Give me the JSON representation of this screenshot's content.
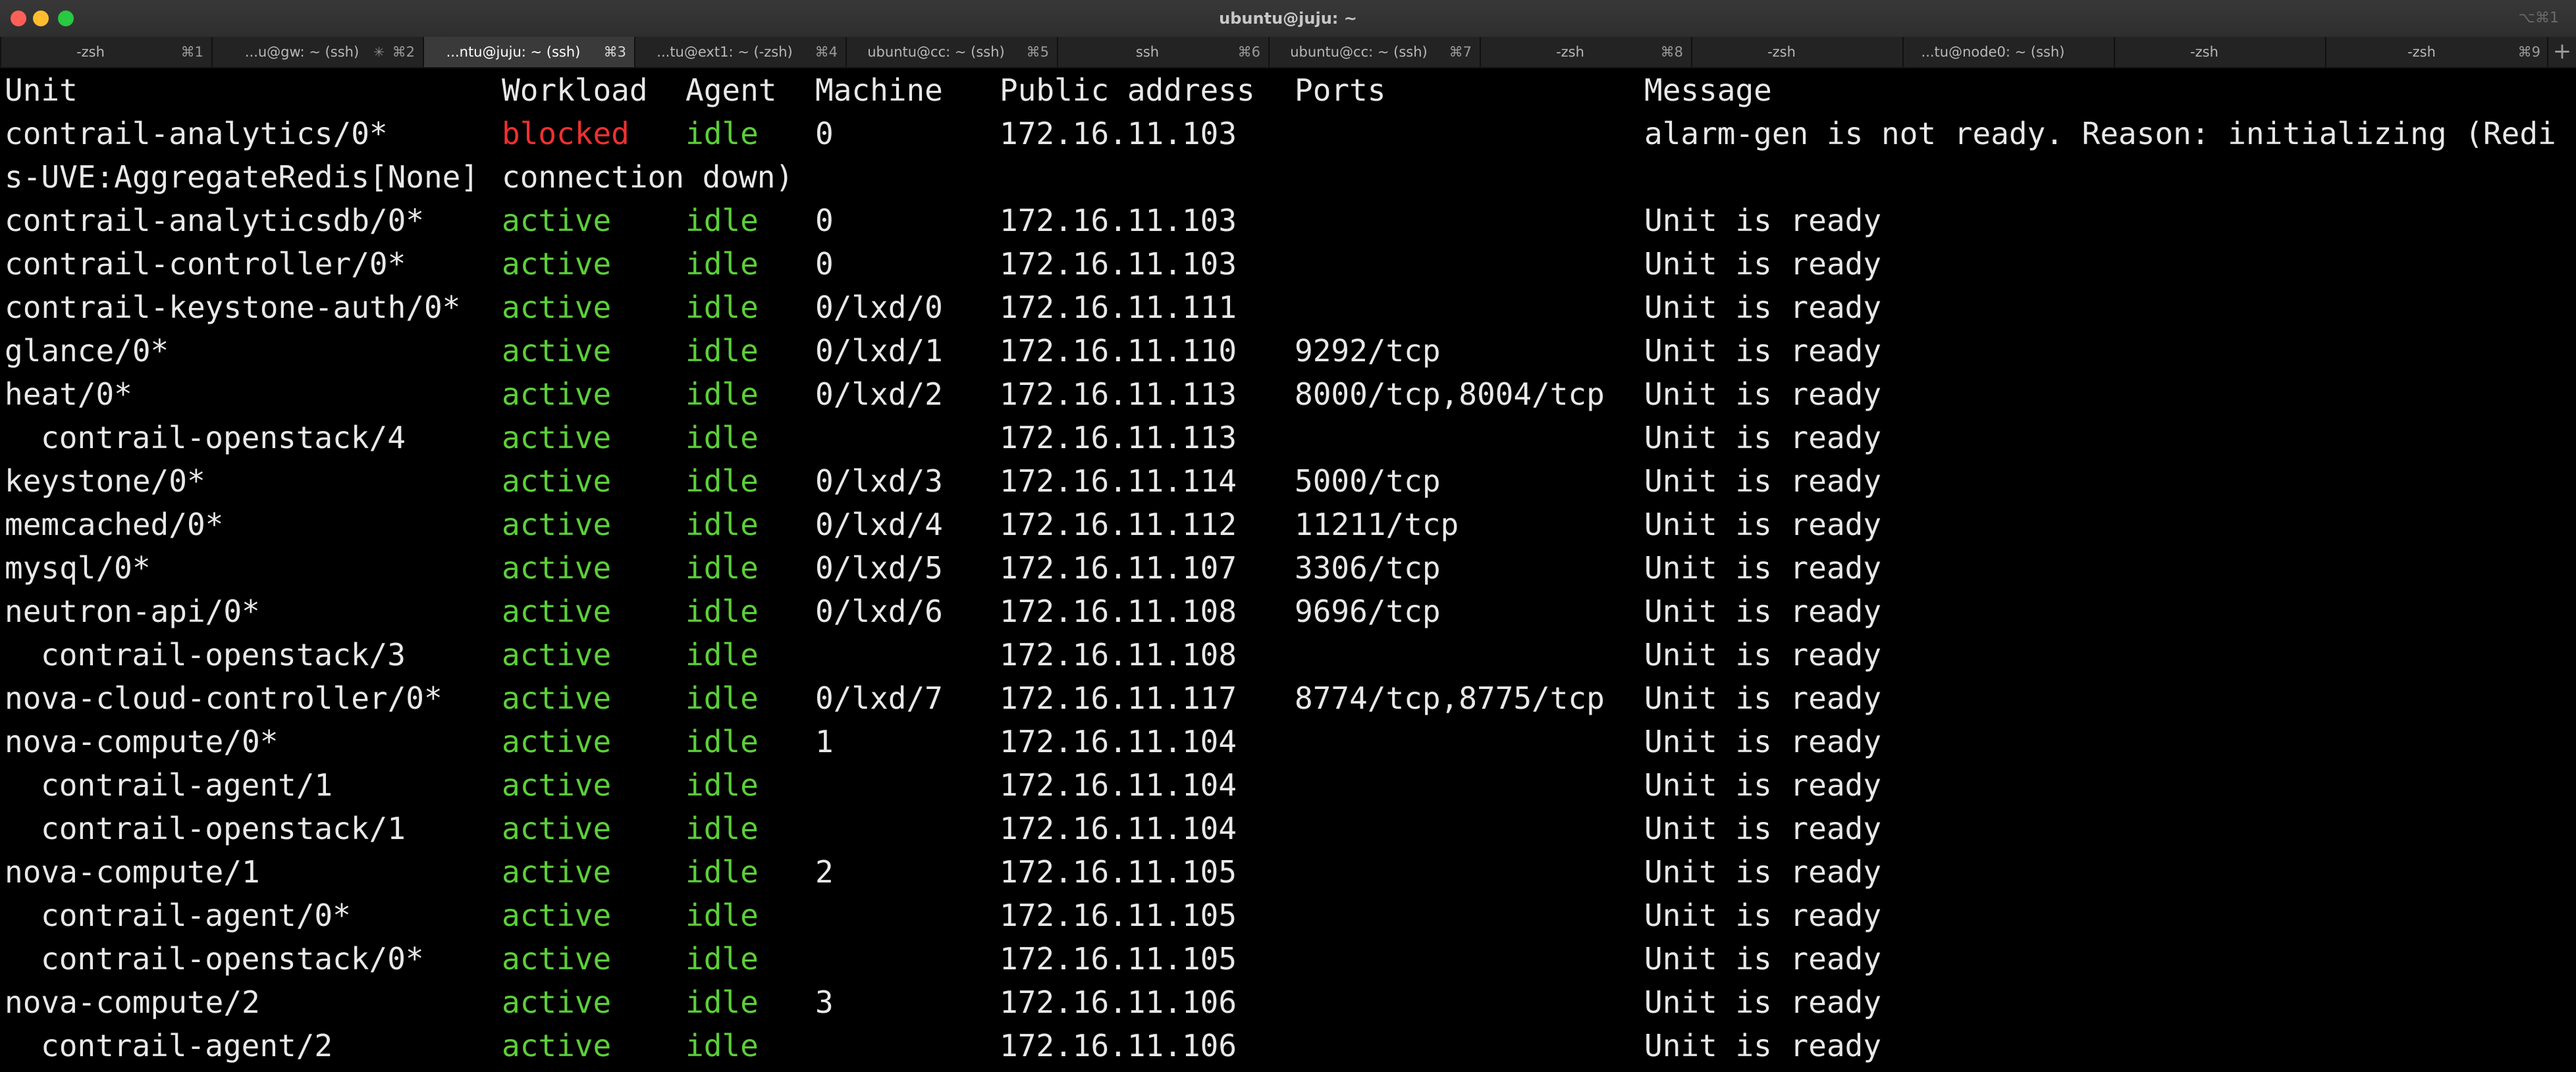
{
  "window": {
    "title": "ubuntu@juju: ~",
    "shortcut": "⌥⌘1"
  },
  "tabs": [
    {
      "label": "-zsh",
      "shortcut": "⌘1",
      "active": false
    },
    {
      "label": "...u@gw: ~ (ssh)",
      "shortcut": "⌘2",
      "active": false,
      "activity_icon": "activity-spinner-icon"
    },
    {
      "label": "...ntu@juju: ~ (ssh)",
      "shortcut": "⌘3",
      "active": true
    },
    {
      "label": "...tu@ext1: ~ (-zsh)",
      "shortcut": "⌘4",
      "active": false
    },
    {
      "label": "ubuntu@cc: ~ (ssh)",
      "shortcut": "⌘5",
      "active": false
    },
    {
      "label": "ssh",
      "shortcut": "⌘6",
      "active": false
    },
    {
      "label": "ubuntu@cc: ~ (ssh)",
      "shortcut": "⌘7",
      "active": false
    },
    {
      "label": "-zsh",
      "shortcut": "⌘8",
      "active": false
    },
    {
      "label": "-zsh",
      "shortcut": "",
      "active": false
    },
    {
      "label": "...tu@node0: ~ (ssh)",
      "shortcut": "",
      "active": false
    },
    {
      "label": "-zsh",
      "shortcut": "",
      "active": false
    },
    {
      "label": "-zsh",
      "shortcut": "⌘9",
      "active": false
    }
  ],
  "new_tab_label": "+",
  "table": {
    "header": {
      "unit": "Unit",
      "workload": "Workload",
      "agent": "Agent",
      "machine": "Machine",
      "address": "Public address",
      "ports": "Ports",
      "message": "Message"
    },
    "rows": [
      {
        "unit": "contrail-analytics/0*",
        "workload": "blocked",
        "agent": "idle",
        "machine": "0",
        "address": "172.16.11.103",
        "ports": "",
        "message": "alarm-gen is not ready. Reason: initializing (Redi"
      },
      {
        "unit": "s-UVE:AggregateRedis[None]",
        "workload": "connection down)",
        "agent": "",
        "machine": "",
        "address": "",
        "ports": "",
        "message": "",
        "continuation": true
      },
      {
        "unit": "contrail-analyticsdb/0*",
        "workload": "active",
        "agent": "idle",
        "machine": "0",
        "address": "172.16.11.103",
        "ports": "",
        "message": "Unit is ready"
      },
      {
        "unit": "contrail-controller/0*",
        "workload": "active",
        "agent": "idle",
        "machine": "0",
        "address": "172.16.11.103",
        "ports": "",
        "message": "Unit is ready"
      },
      {
        "unit": "contrail-keystone-auth/0*",
        "workload": "active",
        "agent": "idle",
        "machine": "0/lxd/0",
        "address": "172.16.11.111",
        "ports": "",
        "message": "Unit is ready"
      },
      {
        "unit": "glance/0*",
        "workload": "active",
        "agent": "idle",
        "machine": "0/lxd/1",
        "address": "172.16.11.110",
        "ports": "9292/tcp",
        "message": "Unit is ready"
      },
      {
        "unit": "heat/0*",
        "workload": "active",
        "agent": "idle",
        "machine": "0/lxd/2",
        "address": "172.16.11.113",
        "ports": "8000/tcp,8004/tcp",
        "message": "Unit is ready"
      },
      {
        "unit": "contrail-openstack/4",
        "workload": "active",
        "agent": "idle",
        "machine": "",
        "address": "172.16.11.113",
        "ports": "",
        "message": "Unit is ready",
        "sub": true
      },
      {
        "unit": "keystone/0*",
        "workload": "active",
        "agent": "idle",
        "machine": "0/lxd/3",
        "address": "172.16.11.114",
        "ports": "5000/tcp",
        "message": "Unit is ready"
      },
      {
        "unit": "memcached/0*",
        "workload": "active",
        "agent": "idle",
        "machine": "0/lxd/4",
        "address": "172.16.11.112",
        "ports": "11211/tcp",
        "message": "Unit is ready"
      },
      {
        "unit": "mysql/0*",
        "workload": "active",
        "agent": "idle",
        "machine": "0/lxd/5",
        "address": "172.16.11.107",
        "ports": "3306/tcp",
        "message": "Unit is ready"
      },
      {
        "unit": "neutron-api/0*",
        "workload": "active",
        "agent": "idle",
        "machine": "0/lxd/6",
        "address": "172.16.11.108",
        "ports": "9696/tcp",
        "message": "Unit is ready"
      },
      {
        "unit": "contrail-openstack/3",
        "workload": "active",
        "agent": "idle",
        "machine": "",
        "address": "172.16.11.108",
        "ports": "",
        "message": "Unit is ready",
        "sub": true
      },
      {
        "unit": "nova-cloud-controller/0*",
        "workload": "active",
        "agent": "idle",
        "machine": "0/lxd/7",
        "address": "172.16.11.117",
        "ports": "8774/tcp,8775/tcp",
        "message": "Unit is ready"
      },
      {
        "unit": "nova-compute/0*",
        "workload": "active",
        "agent": "idle",
        "machine": "1",
        "address": "172.16.11.104",
        "ports": "",
        "message": "Unit is ready"
      },
      {
        "unit": "contrail-agent/1",
        "workload": "active",
        "agent": "idle",
        "machine": "",
        "address": "172.16.11.104",
        "ports": "",
        "message": "Unit is ready",
        "sub": true
      },
      {
        "unit": "contrail-openstack/1",
        "workload": "active",
        "agent": "idle",
        "machine": "",
        "address": "172.16.11.104",
        "ports": "",
        "message": "Unit is ready",
        "sub": true
      },
      {
        "unit": "nova-compute/1",
        "workload": "active",
        "agent": "idle",
        "machine": "2",
        "address": "172.16.11.105",
        "ports": "",
        "message": "Unit is ready"
      },
      {
        "unit": "contrail-agent/0*",
        "workload": "active",
        "agent": "idle",
        "machine": "",
        "address": "172.16.11.105",
        "ports": "",
        "message": "Unit is ready",
        "sub": true
      },
      {
        "unit": "contrail-openstack/0*",
        "workload": "active",
        "agent": "idle",
        "machine": "",
        "address": "172.16.11.105",
        "ports": "",
        "message": "Unit is ready",
        "sub": true
      },
      {
        "unit": "nova-compute/2",
        "workload": "active",
        "agent": "idle",
        "machine": "3",
        "address": "172.16.11.106",
        "ports": "",
        "message": "Unit is ready"
      },
      {
        "unit": "contrail-agent/2",
        "workload": "active",
        "agent": "idle",
        "machine": "",
        "address": "172.16.11.106",
        "ports": "",
        "message": "Unit is ready",
        "sub": true
      }
    ]
  }
}
